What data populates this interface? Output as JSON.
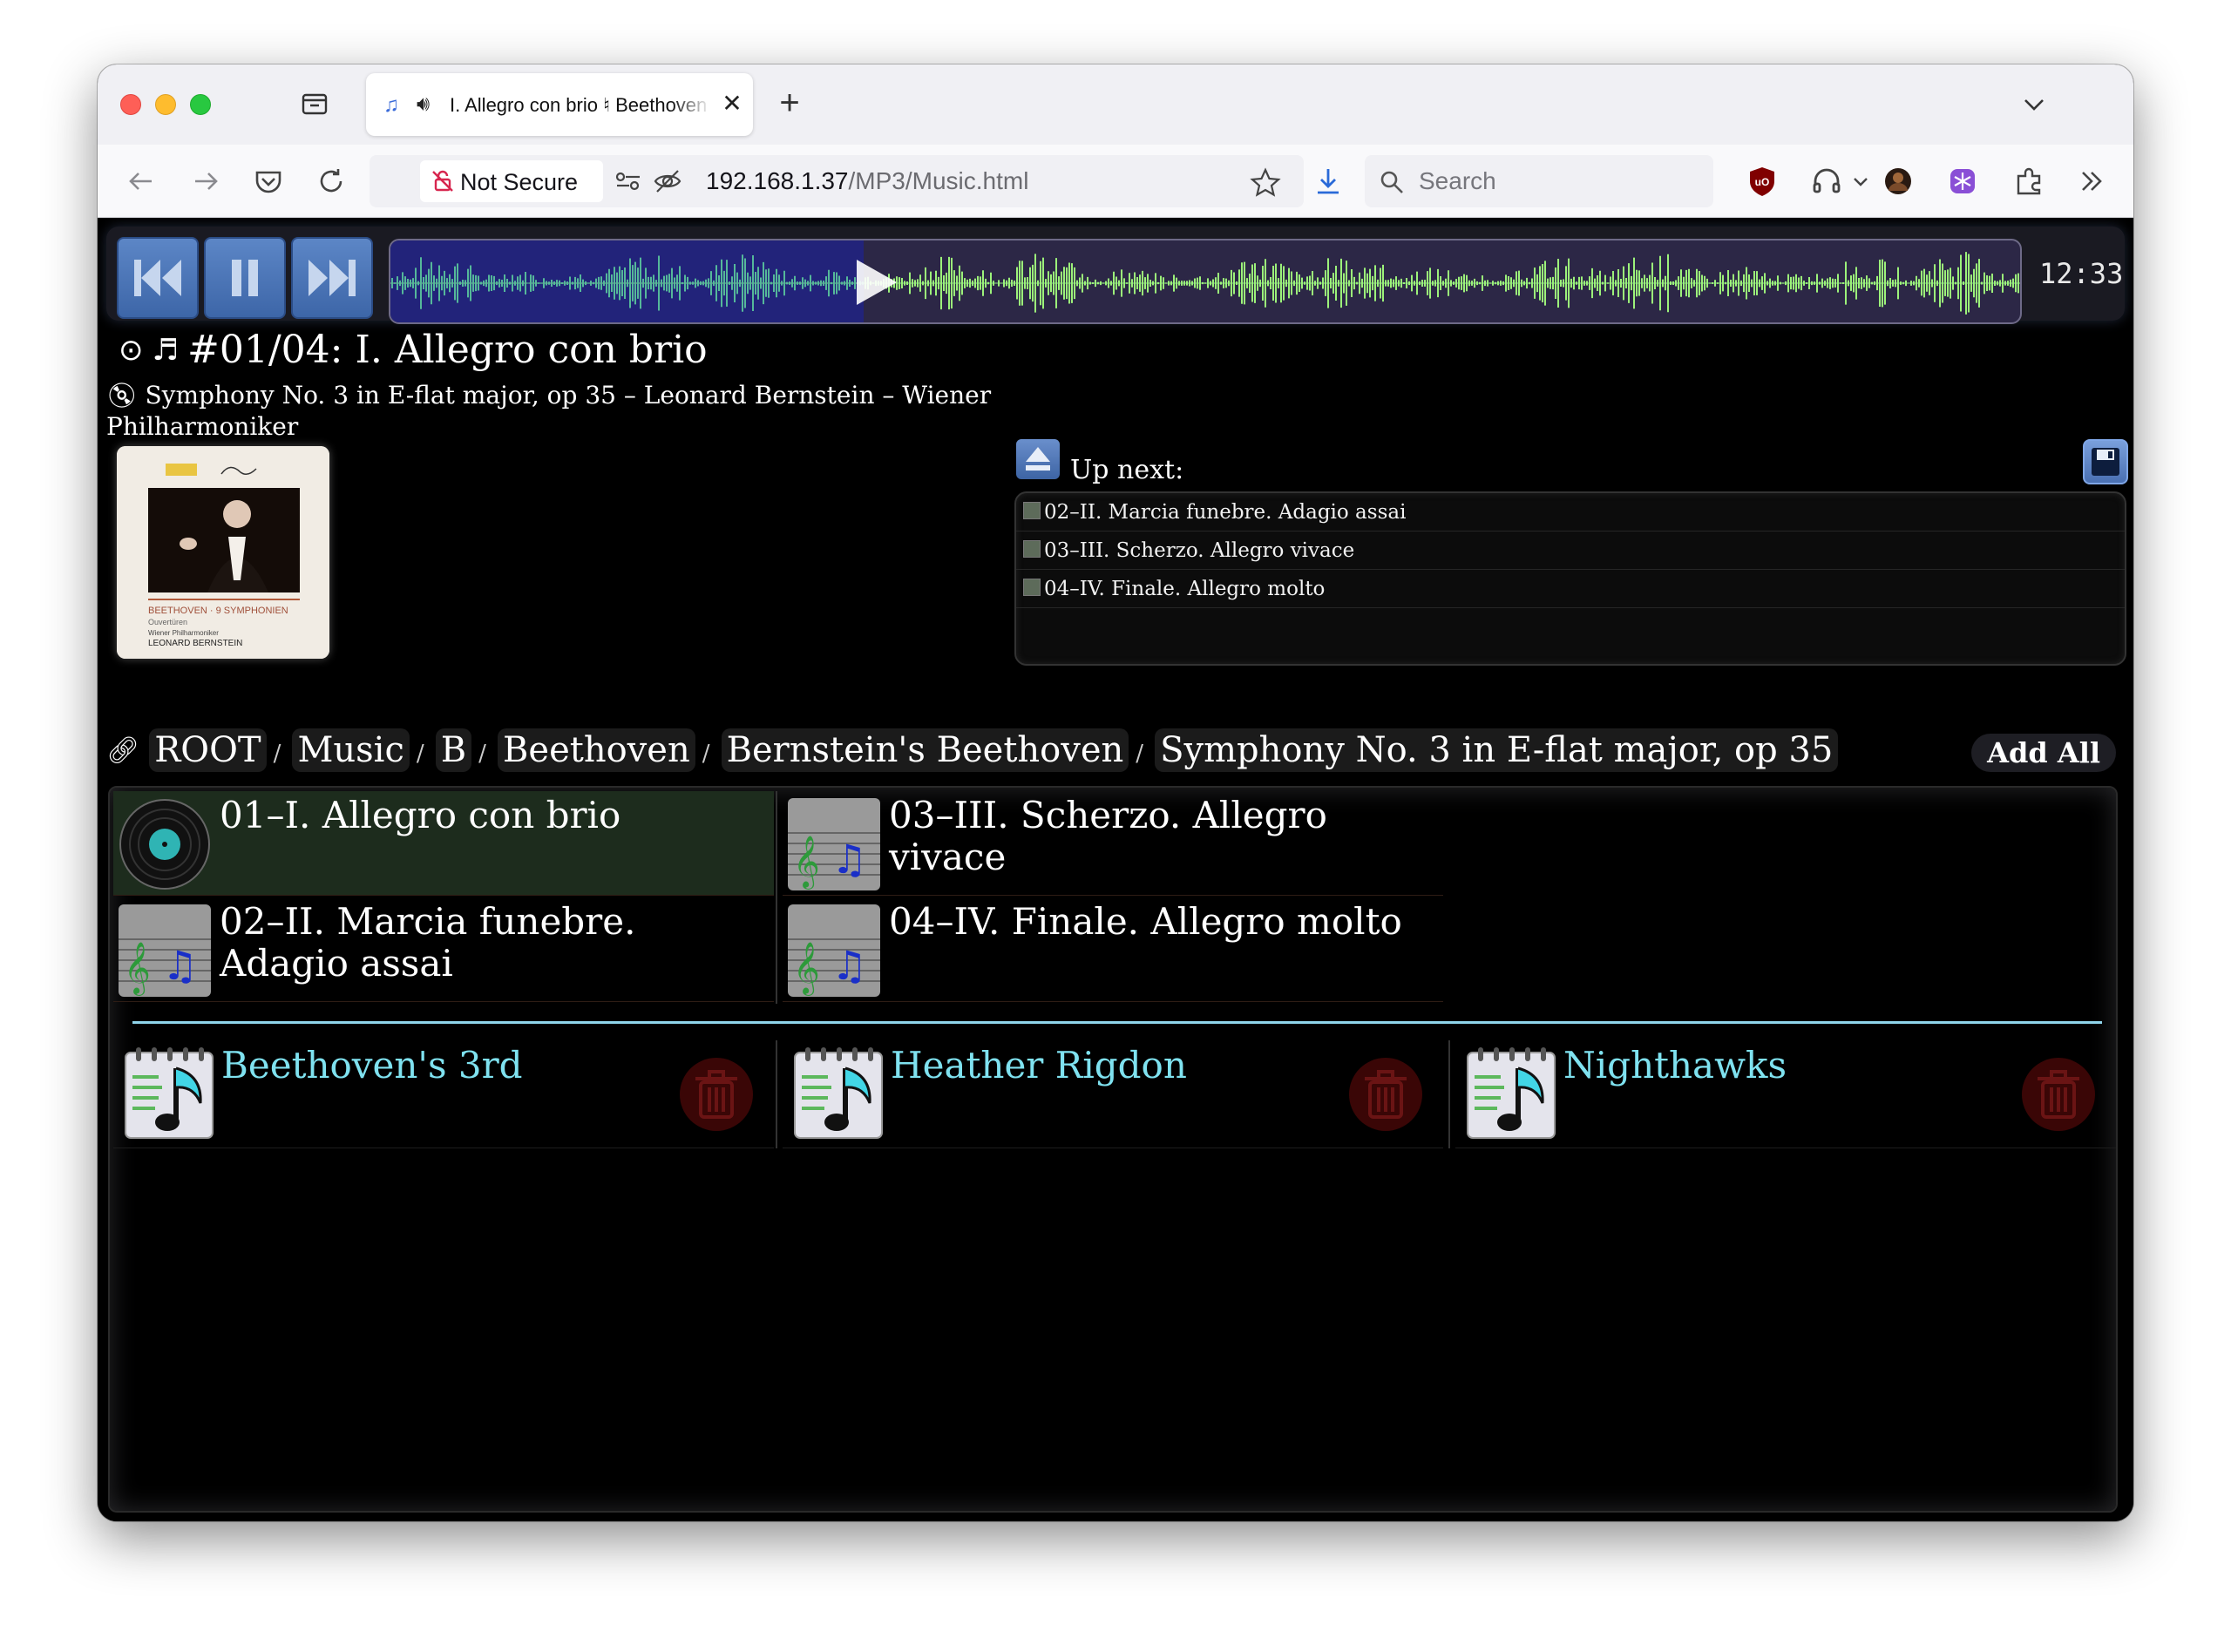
{
  "browser": {
    "tab_title": "I. Allegro con brio ♮ Beethoven",
    "new_tab": "+",
    "not_secure": "Not Secure",
    "url_host": "192.168.1.37",
    "url_path": "/MP3/Music.html",
    "search_placeholder": "Search"
  },
  "player": {
    "time": "12:33",
    "progress_fraction": 0.29
  },
  "now_playing": {
    "title": "#01/04: I. Allegro con brio",
    "album_line": "Symphony No. 3 in E-flat major, op 35 – Leonard Bernstein – Wiener Philharmoniker",
    "cover_text": {
      "series": "BEETHOVEN · 9 SYMPHONIEN",
      "sub": "Ouvertüren",
      "orchestra": "Wiener Philharmoniker",
      "conductor": "LEONARD BERNSTEIN"
    }
  },
  "up_next": {
    "label": "Up next:",
    "items": [
      "02–II. Marcia funebre. Adagio assai",
      "03–III. Scherzo. Allegro vivace",
      "04–IV. Finale. Allegro molto"
    ]
  },
  "breadcrumbs": [
    "ROOT",
    "Music",
    "B",
    "Beethoven",
    "Bernstein's Beethoven",
    "Symphony No. 3 in E-flat major, op 35"
  ],
  "breadcrumb_sep": "/",
  "add_all": "Add All",
  "tracks": [
    "01–I. Allegro con brio",
    "02–II. Marcia funebre. Adagio assai",
    "03–III. Scherzo. Allegro vivace",
    "04–IV. Finale. Allegro molto"
  ],
  "playlists": [
    "Beethoven's 3rd",
    "Heather Rigdon",
    "Nighthawks"
  ],
  "colors": {
    "waveform": "#9cf27a",
    "played_bg": "#22237a",
    "playlist_text": "#7fe2f0",
    "divider": "#8fd4ea"
  },
  "icons": [
    "sidebar-icon",
    "speaker-icon",
    "back-icon",
    "forward-icon",
    "pocket-icon",
    "reload-icon",
    "shield-icon",
    "insecure-lock-icon",
    "permissions-icon",
    "tracking-icon",
    "star-icon",
    "download-icon",
    "search-icon",
    "ublock-icon",
    "headphones-icon",
    "avatar-icon",
    "extension-snowflake-icon",
    "extensions-icon",
    "overflow-icon",
    "menu-icon",
    "skip-back-icon",
    "pause-icon",
    "skip-forward-icon",
    "eject-icon",
    "save-icon",
    "link-icon",
    "vinyl-icon",
    "music-file-icon",
    "playlist-icon",
    "trash-icon"
  ]
}
